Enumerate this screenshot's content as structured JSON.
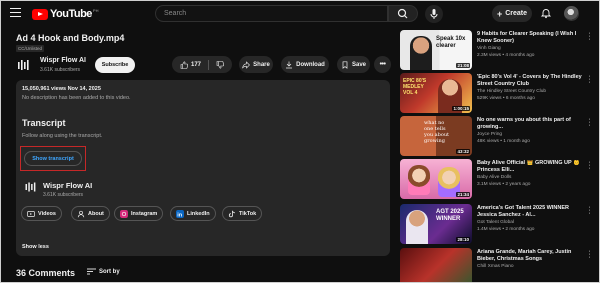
{
  "header": {
    "logo_text": "YouTube",
    "logo_region": "PH",
    "search_placeholder": "Search",
    "create_label": "Create",
    "icons": [
      "menu-icon",
      "search-icon",
      "mic-icon",
      "plus-icon",
      "bell-icon",
      "avatar"
    ]
  },
  "video": {
    "title": "Ad 4 Hook and Body.mp4",
    "visibility": "CC/Unlisted",
    "channel_name": "Wispr Flow AI",
    "channel_subs": "3.61K subscribers",
    "subscribe_label": "Subscribe",
    "likes": "177",
    "share_label": "Share",
    "download_label": "Download",
    "save_label": "Save"
  },
  "description": {
    "stats": "15,050,961 views  Nov 14, 2025",
    "text": "No description has been added to this video.",
    "transcript_title": "Transcript",
    "transcript_sub": "Follow along using the transcript.",
    "transcript_button": "Show transcript",
    "channel_name": "Wispr Flow AI",
    "channel_subs": "3.61K subscribers",
    "links": [
      "Videos",
      "About",
      "Instagram",
      "LinkedIn",
      "TikTok"
    ],
    "show_less": "Show less"
  },
  "comments": {
    "count_label": "36 Comments",
    "sort_label": "Sort by"
  },
  "recommendations": [
    {
      "title": "9 Habits for Clearer Speaking (I Wish I Knew Sooner)",
      "channel": "Vinh Giang",
      "meta": "2.3M views • 4 months ago",
      "duration": "21:08",
      "thumb_text": "Speak 10x clearer"
    },
    {
      "title": "'Epic 80's Vol 4' - Covers by The Hindley Street Country Club",
      "channel": "The Hindley Street Country Club",
      "meta": "529K views • 6 months ago",
      "duration": "1:00:15",
      "thumb_text": "EPIC 80'S MEDLEY VOL 4"
    },
    {
      "title": "No one warns you about this part of growing...",
      "channel": "Joyce Pring",
      "meta": "48K views • 1 month ago",
      "duration": "43:32",
      "thumb_text": "what no one tells you about growing"
    },
    {
      "title": "Baby Alive Official 👑 GROWING UP 👶 Princess Elli...",
      "channel": "Baby Alive Dolls",
      "meta": "3.1M views • 2 years ago",
      "duration": "21:34",
      "thumb_text": ""
    },
    {
      "title": "America's Got Talent 2025 WINNER Jessica Sanchez - Al...",
      "channel": "Got Talent Global",
      "meta": "1.4M views • 2 months ago",
      "duration": "28:10",
      "thumb_text": "AGT 2025 WINNER"
    },
    {
      "title": "Ariana Grande, Mariah Carey, Justin Bieber, Christmas Songs",
      "channel": "Chill Xmas Piano",
      "meta": "",
      "duration": "",
      "thumb_text": ""
    }
  ]
}
